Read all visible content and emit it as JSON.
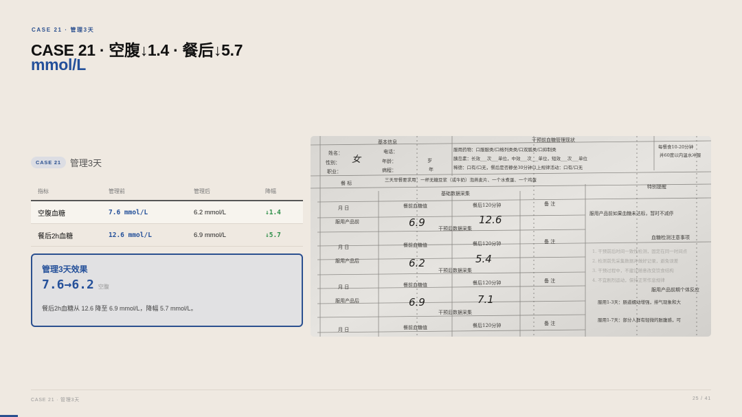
{
  "header": {
    "eyebrow": "CASE 21 · 管理3天",
    "title_line1": "CASE 21 · 空腹↓1.4 · 餐后↓5.7",
    "title_line2": "mmol/L"
  },
  "tag": {
    "badge": "CASE 21",
    "text": "管理3天"
  },
  "table": {
    "headers": [
      "指标",
      "管理前",
      "管理后",
      "降幅"
    ],
    "rows": [
      {
        "metric": "空腹血糖",
        "before": "7.6 mmol/L",
        "after": "6.2 mmol/L",
        "drop": "↓1.4"
      },
      {
        "metric": "餐后2h血糖",
        "before": "12.6 mmol/L",
        "after": "6.9 mmol/L",
        "drop": "↓5.7"
      }
    ]
  },
  "card": {
    "title": "管理3天效果",
    "value": "7.6→6.2",
    "unit": "空腹",
    "description": "餐后2h血糖从 12.6 降至 6.9 mmol/L，降幅 5.7 mmol/L。"
  },
  "photo": {
    "section_basic": "基本信息",
    "section_pre": "干预前血糖管理现状",
    "name_label": "姓名：",
    "phone_label": "电话：",
    "gender_label": "性别：",
    "gender_value": "女",
    "age_label": "年龄：",
    "age_unit": "岁",
    "occupation_label": "职业：",
    "course_label": "病程：",
    "course_unit": "年",
    "med_line1": "服用药物：口服服类/口格列类类/口双胍类/口抑制类",
    "med_line2": "胰岛素：长效___次___单位，中效___次___单位，短效___次___单位",
    "med_line3": "稀德：口有/口无，餐后是否静坐30分钟以上规律活动：口有/口无",
    "right_note1": "每餐食10-20分钟",
    "right_note2": "并60度以内温水冲服",
    "goal_label": "餐 标",
    "goal_text": "三天早餐要求用：一杯无糖豆浆（或牛奶）泡燕麦片、一个水煮蛋、一个鸡蛋",
    "sec1": "基础数据采集",
    "sec2": "干预后数据采集",
    "sec3": "干预后数据采集",
    "sec4": "干预后数据采集",
    "col_date": "月 日",
    "col_fasting": "餐前血糖值",
    "col_post": "餐后120分钟",
    "col_note": "备 注",
    "row_before": "服用产品前",
    "row_after": "服用产品后",
    "hw_r1a": "6.9",
    "hw_r1b": "12.6",
    "hw_r2a": "6.2",
    "hw_r2b": "5.4",
    "hw_r3a": "6.9",
    "hw_r3b": "7.1",
    "right_title": "特别提醒",
    "right_text1": "服用产品前如果血糖未达标，暂时不减停",
    "right_title2": "血糖检测注意事项",
    "right_title3": "服用产品前期个体反应",
    "right_text2": "服用1-3天：肠道蠕动增强，排气现象和大",
    "right_text3": "服用1-7天：部分人群有轻微的胀腹感，可"
  },
  "footer": {
    "left": "CASE 21 · 管理3天",
    "right": "25 / 41"
  },
  "progress": {
    "fraction": 0.024
  }
}
